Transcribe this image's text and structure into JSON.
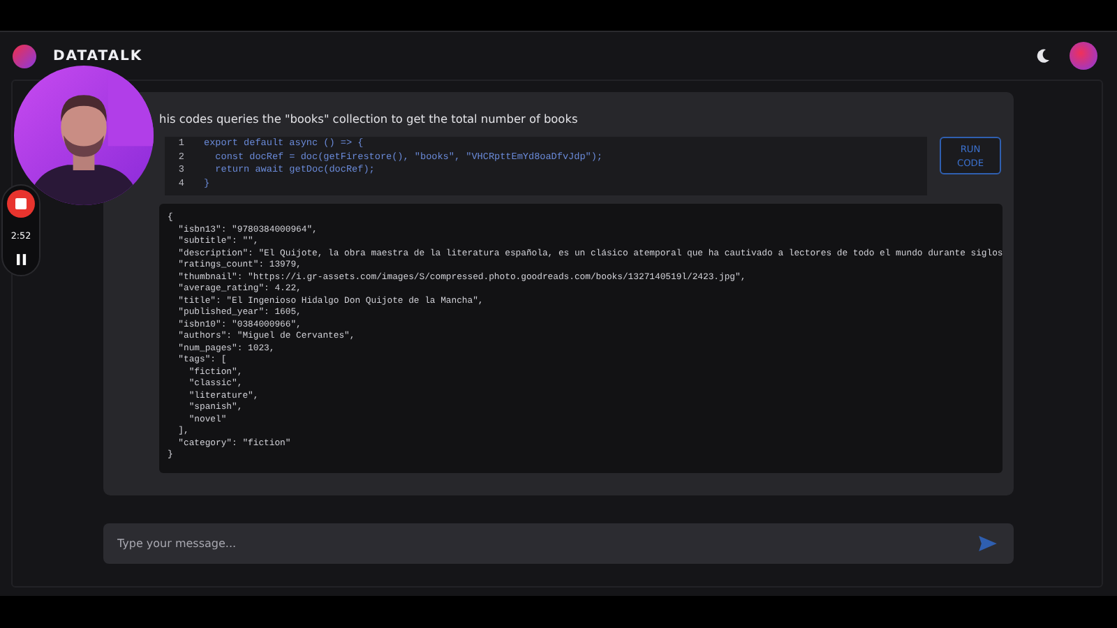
{
  "header": {
    "title": "DATATALK"
  },
  "recorder": {
    "time": "2:52"
  },
  "message": {
    "text": "his codes queries the \"books\" collection to get the total number of books"
  },
  "code": {
    "lines": [
      {
        "number": "1",
        "text": "export default async () => {"
      },
      {
        "number": "2",
        "text": "  const docRef = doc(getFirestore(), \"books\", \"VHCRpttEmYd8oaDfvJdp\");"
      },
      {
        "number": "3",
        "text": "  return await getDoc(docRef);"
      },
      {
        "number": "4",
        "text": "}"
      }
    ],
    "run_button": "RUN\nCODE"
  },
  "output": {
    "lines": [
      "{",
      "  \"isbn13\": \"9780384000964\",",
      "  \"subtitle\": \"\",",
      "  \"description\": \"El Quijote, la obra maestra de la literatura española, es un clásico atemporal que ha cautivado a lectores de todo el mundo durante siglos",
      "  \"ratings_count\": 13979,",
      "  \"thumbnail\": \"https://i.gr-assets.com/images/S/compressed.photo.goodreads.com/books/1327140519l/2423.jpg\",",
      "  \"average_rating\": 4.22,",
      "  \"title\": \"El Ingenioso Hidalgo Don Quijote de la Mancha\",",
      "  \"published_year\": 1605,",
      "  \"isbn10\": \"0384000966\",",
      "  \"authors\": \"Miguel de Cervantes\",",
      "  \"num_pages\": 1023,",
      "  \"tags\": [",
      "    \"fiction\",",
      "    \"classic\",",
      "    \"literature\",",
      "    \"spanish\",",
      "    \"novel\"",
      "  ],",
      "  \"category\": \"fiction\"",
      "}"
    ]
  },
  "input": {
    "placeholder": "Type your message..."
  }
}
